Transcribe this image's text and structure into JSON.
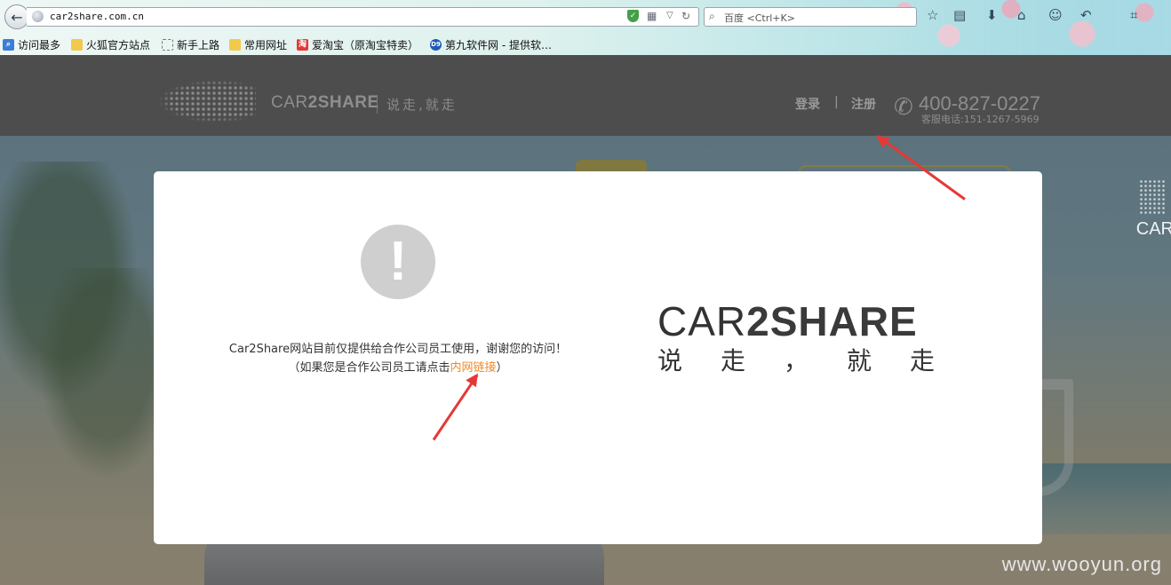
{
  "browser": {
    "url": "car2share.com.cn",
    "search_placeholder": "百度 <Ctrl+K>",
    "bookmarks": [
      {
        "label": "访问最多",
        "icon": "most-visited-icon"
      },
      {
        "label": "火狐官方站点",
        "icon": "folder-icon"
      },
      {
        "label": "新手上路",
        "icon": "page-icon"
      },
      {
        "label": "常用网址",
        "icon": "folder-icon"
      },
      {
        "label": "爱淘宝（原淘宝特卖）",
        "icon": "taobao-icon"
      },
      {
        "label": "第九软件网 - 提供软…",
        "icon": "d9-icon"
      }
    ],
    "toolbar_icons": [
      "bookmark-star-icon",
      "bookmark-manager-icon",
      "download-icon",
      "home-icon",
      "chat-icon",
      "undo-icon",
      "screenshot-icon"
    ]
  },
  "header": {
    "logo_text_regular": "CAR",
    "logo_text_bold": "2SHARE",
    "slogan": "说走,就走",
    "login": "登录",
    "separator": "|",
    "register": "注册",
    "phone": "400-827-0227",
    "service_phone": "客服电话:151-1267-5969"
  },
  "modal": {
    "message_line1": "Car2Share网站目前仅提供给合作公司员工使用，谢谢您的访问！",
    "message_line2_prefix": "（如果您是合作公司员工请点击",
    "intranet_link": "内网链接",
    "message_line2_suffix": "）",
    "brand_regular": "CAR",
    "brand_bold": "2SHARE",
    "brand_slogan": [
      "说",
      "走",
      "，",
      "就",
      "走"
    ]
  },
  "background_fragment": "CAR",
  "watermark": "www.wooyun.org",
  "colors": {
    "header_bg": "#4d4d4d",
    "link_orange": "#f08a24",
    "annotation_arrow": "#e53935",
    "alert_gray": "#cfcfcf"
  }
}
